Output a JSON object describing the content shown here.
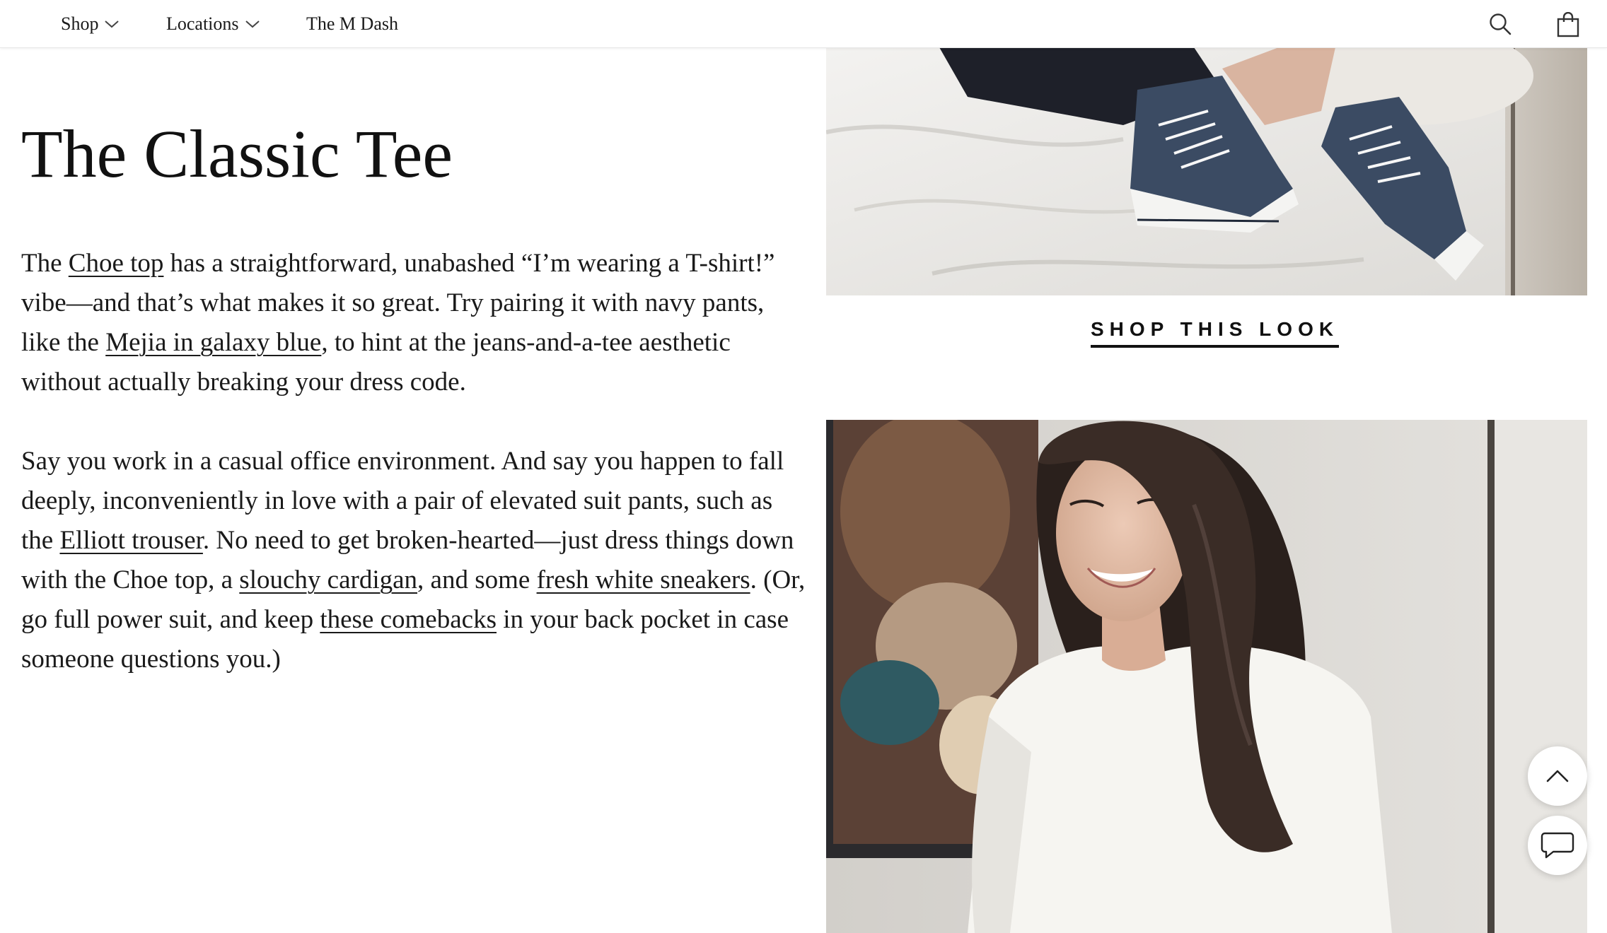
{
  "nav": {
    "shop": "Shop",
    "locations": "Locations",
    "mdash": "The M Dash",
    "icons": [
      "chevron-down-icon",
      "search-icon",
      "shopping-bag-icon"
    ]
  },
  "article": {
    "title": "The Classic Tee",
    "p1": {
      "t1": "The ",
      "link1": "Choe top",
      "t2": " has a straightforward, unabashed “I’m wearing a T-shirt!” vibe—and that’s what makes it so great. Try pairing it with navy pants, like the ",
      "link2": "Mejia in galaxy blue",
      "t3": ", to hint at the jeans-and-a-tee aesthetic without actually breaking your dress code."
    },
    "p2": {
      "t1": "Say you work in a casual office environment. And say you happen to fall deeply, inconveniently in love with a pair of elevated suit pants, such as the ",
      "link1": "Elliott trouser",
      "t2": ". No need to get broken-hearted—just dress things down with the Choe top, a ",
      "link2": "slouchy cardigan",
      "t3": ", and some ",
      "link3": "fresh white sneakers",
      "t4": ". (Or, go full power suit, and keep ",
      "link4": "these comebacks",
      "t5": " in your back pocket in case someone questions you.)"
    }
  },
  "look": {
    "shop_label": "SHOP THIS LOOK"
  },
  "floating": {
    "icons": [
      "chevron-up-icon",
      "chat-bubble-icon"
    ]
  },
  "colors": {
    "text": "#1a1a1a",
    "background": "#ffffff",
    "sneaker_navy": "#3b4b63"
  }
}
